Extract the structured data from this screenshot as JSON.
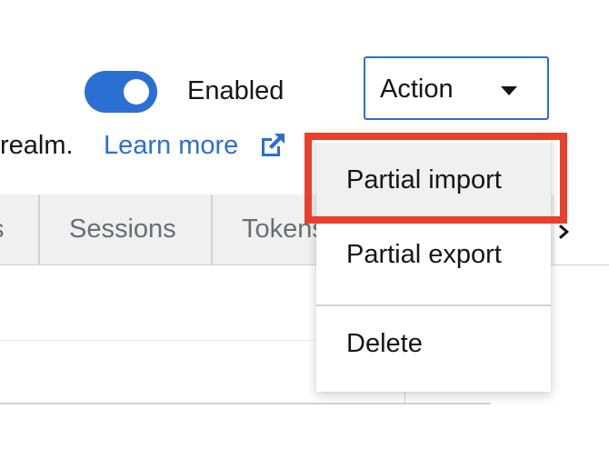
{
  "header": {
    "enabled_label": "Enabled",
    "toggle_on": true,
    "action_label": "Action",
    "realm_text": "realm.",
    "learn_more": "Learn more"
  },
  "tabs": [
    {
      "label": "s"
    },
    {
      "label": "Sessions"
    },
    {
      "label": "Tokens"
    }
  ],
  "action_menu": {
    "items": [
      {
        "label": "Partial import",
        "highlighted": true
      },
      {
        "label": "Partial export"
      },
      {
        "label": "Delete"
      }
    ]
  },
  "colors": {
    "accent": "#2b6fd3",
    "highlight": "#e8402a",
    "tab_bg": "#f0f0f0",
    "tab_text": "#6a6e73"
  }
}
